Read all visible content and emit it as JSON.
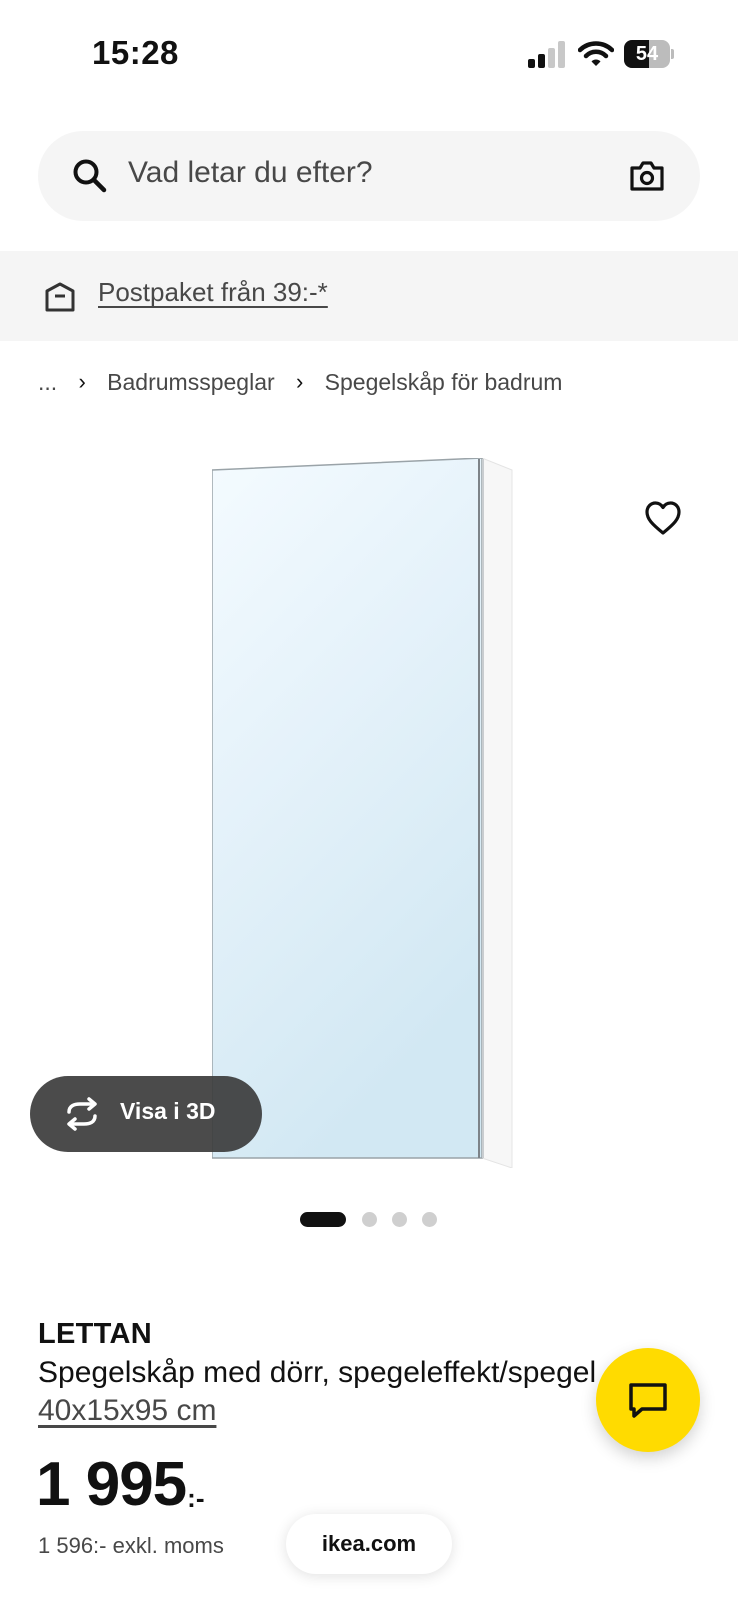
{
  "status_bar": {
    "time": "15:28",
    "battery_level": "54",
    "battery_percent": 54,
    "signal_bars_active": 2,
    "icons": [
      "cellular-signal-icon",
      "wifi-icon",
      "battery-icon"
    ]
  },
  "search": {
    "placeholder": "Vad letar du efter?",
    "icons": [
      "search-icon",
      "camera-icon"
    ]
  },
  "promo": {
    "text": "Postpaket från 39:-*",
    "icon": "box-icon"
  },
  "breadcrumb": {
    "ellipsis": "...",
    "items": [
      "Badrumsspeglar",
      "Spegelskåp för badrum"
    ]
  },
  "gallery": {
    "view_3d_label": "Visa i 3D",
    "image_count": 4,
    "active_index": 0,
    "icons": [
      "heart-icon",
      "rotate-icon"
    ]
  },
  "product": {
    "name": "LETTAN",
    "description": "Spegelskåp med dörr, spegeleffekt/spegel",
    "size": "40x15x95 cm",
    "price": "1 995",
    "price_suffix": ":-",
    "price_ex_vat": "1 596:- exkl. moms"
  },
  "browser": {
    "url": "ikea.com"
  },
  "chat": {
    "icon": "chat-bubble-icon"
  },
  "colors": {
    "brand_yellow": "#ffdb00",
    "text": "#111111",
    "muted": "#484848",
    "panel": "#f5f5f5"
  }
}
